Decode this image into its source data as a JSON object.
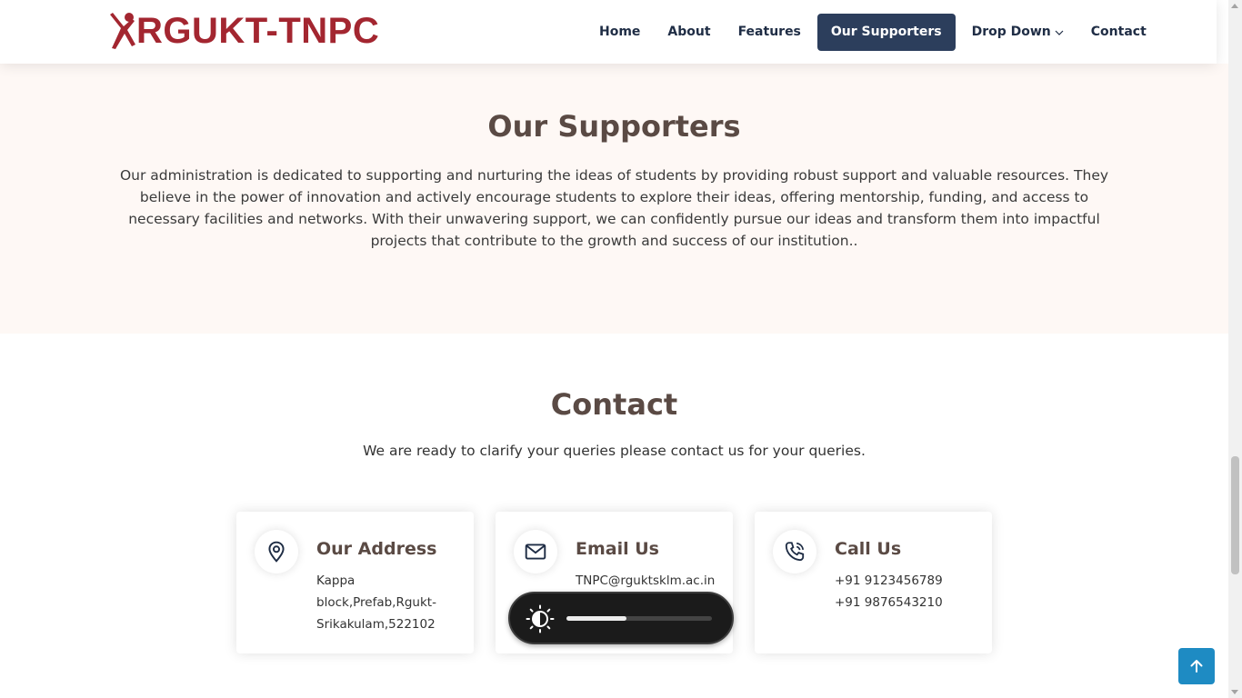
{
  "header": {
    "logo_text": "RGUKT-TNPC",
    "nav": [
      {
        "label": "Home"
      },
      {
        "label": "About"
      },
      {
        "label": "Features"
      },
      {
        "label": "Our Supporters",
        "active": true
      },
      {
        "label": "Drop Down"
      },
      {
        "label": "Contact"
      }
    ]
  },
  "supporters": {
    "title": "Our Supporters",
    "text": "Our administration is dedicated to supporting and nurturing the ideas of students by providing robust support and valuable resources. They believe in the power of innovation and actively encourage students to explore their ideas, offering mentorship, funding, and access to necessary facilities and networks. With their unwavering support, we can confidently pursue our ideas and transform them into impactful projects that contribute to the growth and success of our institution.."
  },
  "contact": {
    "title": "Contact",
    "subtitle": "We are ready to clarify your queries please contact us for your queries.",
    "cards": [
      {
        "icon": "map-pin-icon",
        "title": "Our Address",
        "lines": [
          "Kappa",
          "block,Prefab,Rgukt-",
          "Srikakulam,522102"
        ]
      },
      {
        "icon": "envelope-icon",
        "title": "Email Us",
        "lines": [
          "TNPC@rguktsklm.ac.in"
        ]
      },
      {
        "icon": "phone-icon",
        "title": "Call Us",
        "lines": [
          "+91 9123456789",
          "+91 9876543210"
        ]
      }
    ]
  },
  "brightness": {
    "level": 0.41,
    "icon": "brightness-icon"
  },
  "back_to_top": {
    "icon": "arrow-up-icon"
  },
  "colors": {
    "brand": "#a32630",
    "nav_active_bg": "#2c3e5c",
    "section_bg": "#fef8f5",
    "heading": "#5a4a44",
    "accent": "#1e8bc3"
  }
}
